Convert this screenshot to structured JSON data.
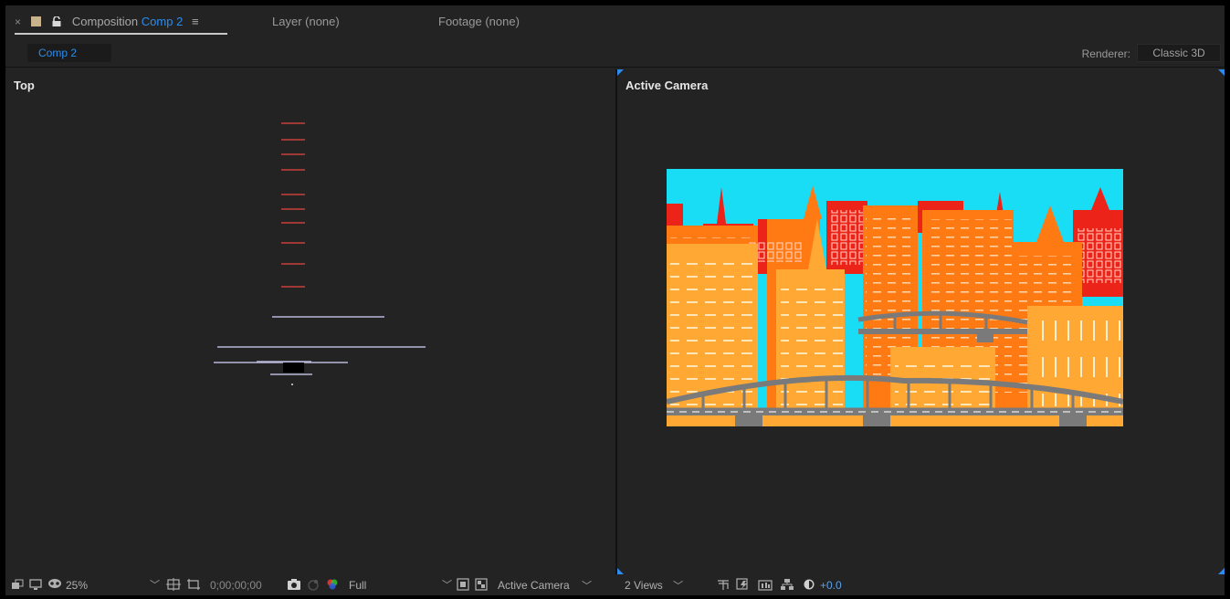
{
  "tabs": {
    "composition": {
      "close": "×",
      "prefix": "Composition",
      "name": "Comp 2",
      "menu": "≡"
    },
    "layer": {
      "label": "Layer (none)"
    },
    "footage": {
      "label": "Footage (none)"
    }
  },
  "subbar": {
    "comp_pill": "Comp 2",
    "renderer_label": "Renderer:",
    "renderer_value": "Classic 3D"
  },
  "views": {
    "left_label": "Top",
    "right_label": "Active Camera"
  },
  "toolbar": {
    "zoom": "25%",
    "timecode": "0;00;00;00",
    "resolution": "Full",
    "camera_view": "Active Camera",
    "layout": "2 Views",
    "exposure": "+0.0"
  },
  "colors": {
    "accent": "#2d8ceb",
    "panel_bg": "#232323",
    "sky": "#19dcf5",
    "building_red": "#ec2318",
    "building_orange": "#ff7a12",
    "building_light": "#ffa833",
    "bridge_gray": "#7a7a7a"
  },
  "icons": {
    "tab": [
      "close-icon",
      "color-swatch-icon",
      "lock-icon",
      "panel-menu-icon"
    ],
    "toolbar": [
      "always-preview-icon",
      "monitor-icon",
      "mask-icon",
      "region-of-interest-icon",
      "transparency-grid-icon",
      "snapshot-icon",
      "show-snapshot-icon",
      "channel-icon",
      "fast-preview-icon",
      "toggle-transparency-icon",
      "3d-draft-icon",
      "flowchart-icon",
      "reset-exposure-icon"
    ]
  }
}
